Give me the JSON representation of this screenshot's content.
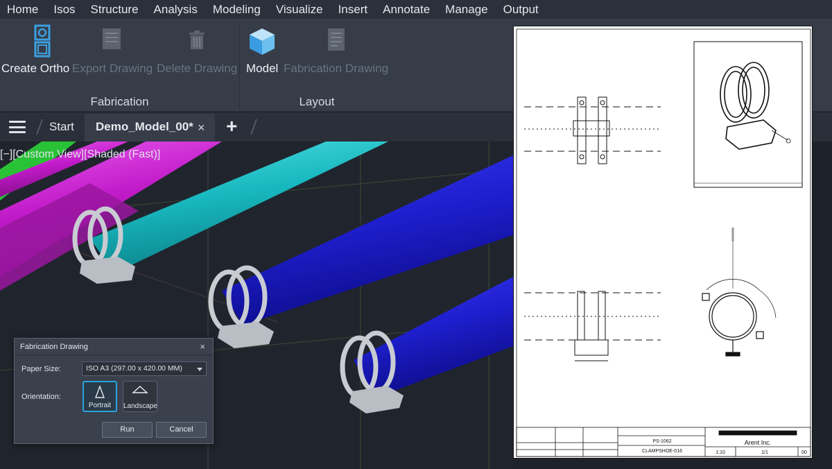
{
  "menu": [
    "Home",
    "Isos",
    "Structure",
    "Analysis",
    "Modeling",
    "Visualize",
    "Insert",
    "Annotate",
    "Manage",
    "Output"
  ],
  "ribbon": {
    "fabrication": {
      "label": "Fabrication",
      "create_ortho": "Create Ortho",
      "export_drawing": "Export Drawing",
      "delete_drawing": "Delete Drawing"
    },
    "layout": {
      "label": "Layout",
      "model": "Model",
      "fabrication_drawing": "Fabrication Drawing"
    }
  },
  "tabs": {
    "start": "Start",
    "active": "Demo_Model_00*",
    "close": "×",
    "add": "+"
  },
  "viewport": {
    "label": "[−][Custom View][Shaded (Fast)]"
  },
  "dialog": {
    "title": "Fabrication Drawing",
    "close": "×",
    "paper_size_label": "Paper Size:",
    "paper_size_value": "ISO A3 (297.00 x 420.00 MM)",
    "orientation_label": "Orientation:",
    "portrait": "Portrait",
    "landscape": "Landscape",
    "selected_orientation": "Portrait",
    "run": "Run",
    "cancel": "Cancel"
  },
  "sheet": {
    "company": "Arent Inc.",
    "drawing_no": "PS-1062",
    "title": "CLAMPSHOE-016",
    "scale": "1:10",
    "sheet": "1/1",
    "rev": "00"
  },
  "colors": {
    "accent": "#2aa4dc",
    "pipe_blue": "#1f1fd0",
    "pipe_cyan": "#18b8bf",
    "pipe_magenta": "#c21bc9"
  }
}
